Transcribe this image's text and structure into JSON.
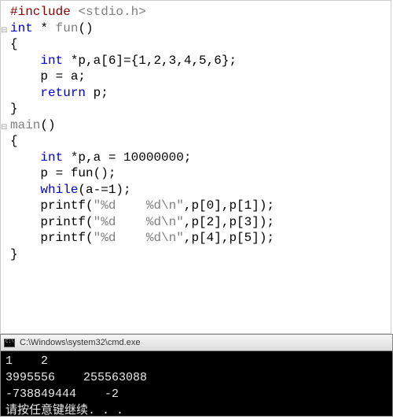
{
  "editor": {
    "lines": [
      {
        "segs": [
          {
            "t": "#include ",
            "c": "k-pre"
          },
          {
            "t": "<stdio.h>",
            "c": "k-inc"
          }
        ]
      },
      {
        "mark": "⊟",
        "segs": [
          {
            "t": "int",
            "c": "k-type"
          },
          {
            "t": " * ",
            "c": "k-txt"
          },
          {
            "t": "fun",
            "c": "k-fun"
          },
          {
            "t": "()",
            "c": "k-txt"
          }
        ]
      },
      {
        "segs": [
          {
            "t": "{",
            "c": "k-txt"
          }
        ]
      },
      {
        "segs": [
          {
            "t": "    ",
            "c": "k-txt"
          },
          {
            "t": "int",
            "c": "k-type"
          },
          {
            "t": " *p,a[6]={1,2,3,4,5,6};",
            "c": "k-txt"
          }
        ]
      },
      {
        "segs": [
          {
            "t": "    p = a;",
            "c": "k-txt"
          }
        ]
      },
      {
        "segs": [
          {
            "t": "    ",
            "c": "k-txt"
          },
          {
            "t": "return",
            "c": "k-kw"
          },
          {
            "t": " p;",
            "c": "k-txt"
          }
        ]
      },
      {
        "segs": [
          {
            "t": "}",
            "c": "k-txt"
          }
        ]
      },
      {
        "segs": [
          {
            "t": "",
            "c": "k-txt"
          }
        ]
      },
      {
        "mark": "⊟",
        "segs": [
          {
            "t": "main",
            "c": "k-fun"
          },
          {
            "t": "()",
            "c": "k-txt"
          }
        ]
      },
      {
        "segs": [
          {
            "t": "{",
            "c": "k-txt"
          }
        ]
      },
      {
        "segs": [
          {
            "t": "    ",
            "c": "k-txt"
          },
          {
            "t": "int",
            "c": "k-type"
          },
          {
            "t": " *p,a = 10000000;",
            "c": "k-txt"
          }
        ]
      },
      {
        "segs": [
          {
            "t": "    p = fun();",
            "c": "k-txt"
          }
        ]
      },
      {
        "segs": [
          {
            "t": "    ",
            "c": "k-txt"
          },
          {
            "t": "while",
            "c": "k-kw"
          },
          {
            "t": "(a-=1);",
            "c": "k-txt"
          }
        ]
      },
      {
        "segs": [
          {
            "t": "    printf(",
            "c": "k-txt"
          },
          {
            "t": "\"%d    %d\\n\"",
            "c": "k-str"
          },
          {
            "t": ",p[0],p[1]);",
            "c": "k-txt"
          }
        ]
      },
      {
        "segs": [
          {
            "t": "    printf(",
            "c": "k-txt"
          },
          {
            "t": "\"%d    %d\\n\"",
            "c": "k-str"
          },
          {
            "t": ",p[2],p[3]);",
            "c": "k-txt"
          }
        ]
      },
      {
        "segs": [
          {
            "t": "    printf(",
            "c": "k-txt"
          },
          {
            "t": "\"%d    %d\\n\"",
            "c": "k-str"
          },
          {
            "t": ",p[4],p[5]);",
            "c": "k-txt"
          }
        ]
      },
      {
        "segs": [
          {
            "t": "}",
            "c": "k-txt"
          }
        ]
      }
    ]
  },
  "terminal": {
    "title": "C:\\Windows\\system32\\cmd.exe",
    "output": "1    2\n3995556    255563088\n-738849444    -2\n请按任意键继续. . ."
  }
}
